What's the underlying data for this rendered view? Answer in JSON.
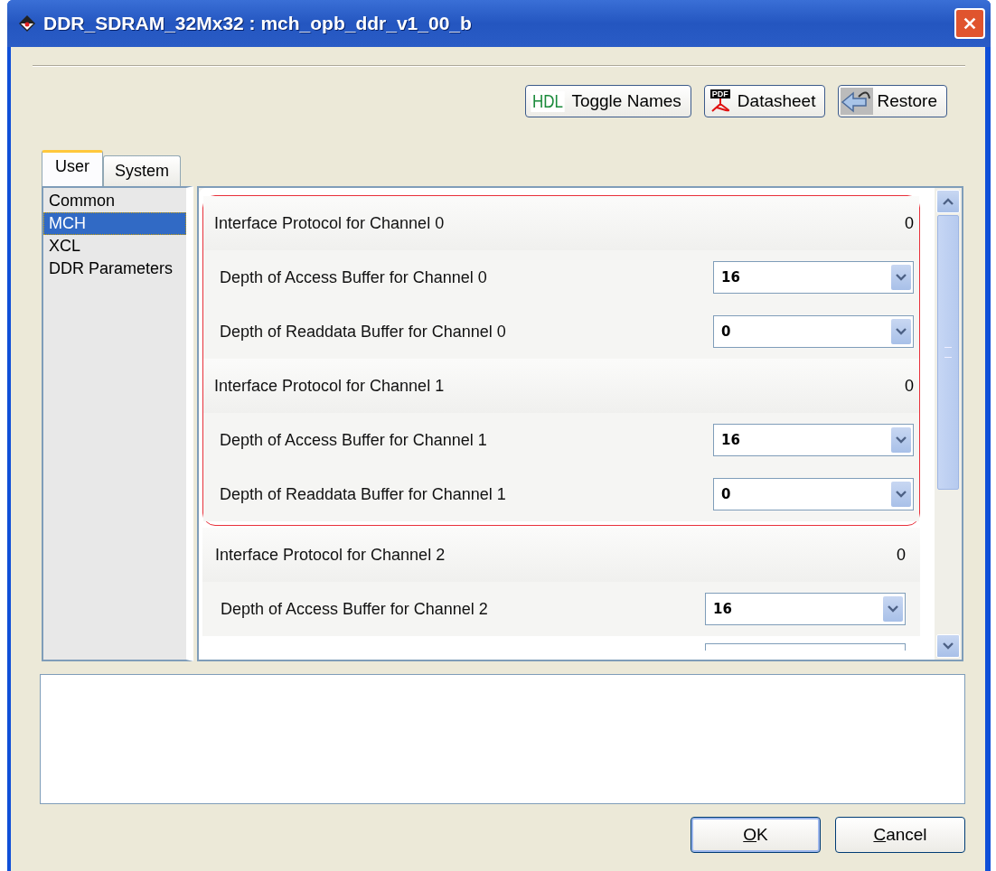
{
  "window": {
    "title": "DDR_SDRAM_32Mx32 : mch_opb_ddr_v1_00_b"
  },
  "toolbar": [
    {
      "kind": "hdl",
      "icon_text": "HDL",
      "label": "Toggle Names"
    },
    {
      "kind": "pdf",
      "icon_text": "PDF",
      "label": "Datasheet"
    },
    {
      "kind": "restore",
      "label": "Restore"
    }
  ],
  "tabs": [
    {
      "label": "User",
      "selected": true
    },
    {
      "label": "System",
      "selected": false
    }
  ],
  "categories": [
    {
      "label": "Common",
      "selected": false
    },
    {
      "label": "MCH",
      "selected": true
    },
    {
      "label": "XCL",
      "selected": false
    },
    {
      "label": "DDR Parameters",
      "selected": false
    }
  ],
  "groups": [
    {
      "highlighted": true,
      "rows": [
        {
          "kind": "value",
          "label": "Interface Protocol for Channel 0",
          "value": "0"
        },
        {
          "kind": "combo",
          "label": "Depth of Access Buffer for Channel 0",
          "value": "16"
        },
        {
          "kind": "combo",
          "label": "Depth of Readdata Buffer for Channel 0",
          "value": "0"
        },
        {
          "kind": "value",
          "label": "Interface Protocol for Channel 1",
          "value": "0"
        },
        {
          "kind": "combo",
          "label": "Depth of Access Buffer for Channel 1",
          "value": "16"
        },
        {
          "kind": "combo",
          "label": "Depth of Readdata Buffer for Channel 1",
          "value": "0"
        }
      ]
    },
    {
      "highlighted": false,
      "rows": [
        {
          "kind": "value",
          "label": "Interface Protocol for Channel 2",
          "value": "0"
        },
        {
          "kind": "combo",
          "label": "Depth of Access Buffer for Channel 2",
          "value": "16"
        },
        {
          "kind": "clipped_combo"
        }
      ]
    }
  ],
  "buttons": [
    {
      "accel": "O",
      "rest": "K",
      "default": true
    },
    {
      "accel": "C",
      "rest": "ancel",
      "default": false
    }
  ]
}
